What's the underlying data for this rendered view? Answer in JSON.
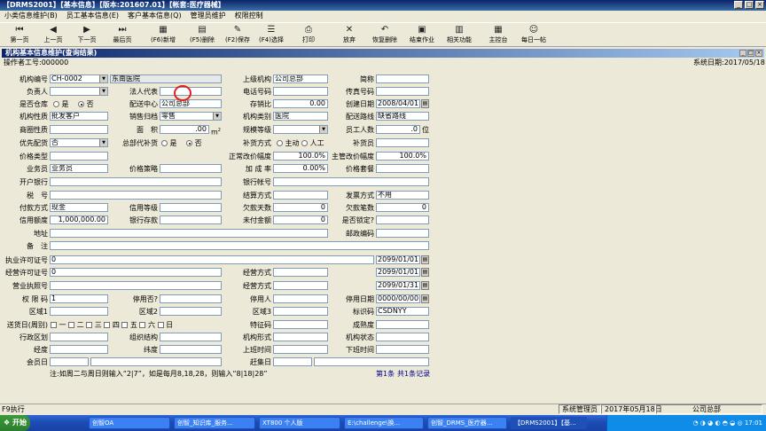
{
  "window": {
    "title": "【DRMS2001】【基本信息】【版本:201607.01】【帐套:医疗器械】"
  },
  "menu": [
    "小类信息维护(B)",
    "员工基本信息(E)",
    "客户基本信息(Q)",
    "管理员维护",
    "权限控制"
  ],
  "toolbar": [
    {
      "name": "first",
      "icon": "⏮",
      "label": "第一页"
    },
    {
      "name": "prev",
      "icon": "◀",
      "label": "上一页"
    },
    {
      "name": "next",
      "icon": "▶",
      "label": "下一页"
    },
    {
      "name": "last",
      "icon": "⏭",
      "label": "最后页"
    },
    {
      "name": "new",
      "icon": "▦",
      "label": "(F6)新增"
    },
    {
      "name": "delete",
      "icon": "▤",
      "label": "(F5)删除"
    },
    {
      "name": "save",
      "icon": "✎",
      "label": "(F2)保存"
    },
    {
      "name": "select",
      "icon": "☰",
      "label": "(F4)选择"
    },
    {
      "name": "print",
      "icon": "⎙",
      "label": "打印"
    },
    {
      "name": "abandon",
      "icon": "✕",
      "label": "放弃"
    },
    {
      "name": "restore",
      "icon": "↶",
      "label": "恢复删除"
    },
    {
      "name": "end",
      "icon": "▣",
      "label": "结束作业"
    },
    {
      "name": "related",
      "icon": "▥",
      "label": "相关功能"
    },
    {
      "name": "console",
      "icon": "▦",
      "label": "主控台"
    },
    {
      "name": "daily",
      "icon": "☺",
      "label": "每日一帖"
    }
  ],
  "frame": {
    "title": "机构基本信息维护(查询结果)",
    "operator": "操作者工号:000000",
    "sysdate": "系统日期:2017/05/18"
  },
  "f": {
    "jgbh": {
      "label": "机构编号",
      "value": "CH-0002"
    },
    "jgname": {
      "value": "东南医院"
    },
    "sjjg": {
      "label": "上级机构",
      "value": "公司总部"
    },
    "jc": {
      "label": "简称"
    },
    "fzr": {
      "label": "负责人"
    },
    "frdb": {
      "label": "法人代表"
    },
    "dhhm": {
      "label": "电话号码"
    },
    "czhm": {
      "label": "传真号码"
    },
    "sfck": {
      "label": "是否仓库",
      "yes": "是",
      "no": "否"
    },
    "pszx": {
      "label": "配送中心",
      "value": "公司总部"
    },
    "cxb": {
      "label": "存销比",
      "value": "0.00"
    },
    "cjrq": {
      "label": "创建日期",
      "value": "2008/04/01"
    },
    "jgxz": {
      "label": "机构性质",
      "value": "批发客户"
    },
    "xsgs": {
      "label": "销售归档",
      "value": "零售"
    },
    "jglb": {
      "label": "机构类别",
      "value": "医院"
    },
    "psxl": {
      "label": "配送路线",
      "value": "缺省路线"
    },
    "sqmc": {
      "label": "商圈性质"
    },
    "mj": {
      "label": "面　积",
      "value": ".00",
      "unit": "m",
      "sup": "2"
    },
    "gmdj": {
      "label": "规模等级"
    },
    "ygrs": {
      "label": "员工人数",
      "value": ".0",
      "unit": "位"
    },
    "yxps": {
      "label": "优先配货",
      "value": "否"
    },
    "zbdbh": {
      "label": "总部代补货",
      "yes": "是",
      "no": "否"
    },
    "bhfs": {
      "label": "补货方式",
      "a": "主动",
      "b": "人工"
    },
    "bhy": {
      "label": "补货员"
    },
    "jglx": {
      "label": "价格类型"
    },
    "zcgjfd": {
      "label": "正常改价幅度",
      "value": "100.0%"
    },
    "zggjfd": {
      "label": "主管改价幅度",
      "value": "100.0%"
    },
    "ywy": {
      "label": "业务员",
      "value": "业务员"
    },
    "jgcl": {
      "label": "价格策略"
    },
    "jcl": {
      "label": "加 成 率",
      "value": "0.00%"
    },
    "jgrq": {
      "label": "价格套餐"
    },
    "khyh": {
      "label": "开户银行"
    },
    "yhzh": {
      "label": "银行帐号"
    },
    "sh": {
      "label": "税　号"
    },
    "jsfs": {
      "label": "结算方式"
    },
    "fpfs": {
      "label": "发票方式",
      "value": "不用"
    },
    "fkfs": {
      "label": "付款方式",
      "value": "现金"
    },
    "xydj": {
      "label": "信用等级"
    },
    "qkts": {
      "label": "欠款天数",
      "value": "0"
    },
    "qkbs": {
      "label": "欠款笔数",
      "value": "0"
    },
    "xyed": {
      "label": "信用额度",
      "value": "1,000,000.00"
    },
    "yhck": {
      "label": "银行存款"
    },
    "wfje": {
      "label": "未付金额",
      "value": "0"
    },
    "sfsd": {
      "label": "是否锁定?"
    },
    "dz": {
      "label": "地址"
    },
    "yzbm": {
      "label": "邮政编码"
    },
    "bz": {
      "label": "备　注"
    },
    "zyxk": {
      "label": "执业许可证号",
      "value": "0",
      "date": "2099/01/01"
    },
    "jyxk": {
      "label": "经营许可证号",
      "value": "0",
      "fw": "经营方式",
      "date": "2099/01/01"
    },
    "yyzz": {
      "label": "营业执照号",
      "fw": "经营方式",
      "date": "2099/01/31"
    },
    "qxm": {
      "label": "权 限 码",
      "value": "1",
      "tyf": "停用否?",
      "tyr": "停用人",
      "tyrq": "停用日期",
      "tyrqv": "0000/00/00"
    },
    "qy1": {
      "label": "区域1",
      "qy2": "区域2",
      "qy3": "区域3",
      "bjm": "标识码",
      "bjmv": "CSDNYY"
    },
    "shr": {
      "label": "送货日(周别)",
      "days": [
        "一",
        "二",
        "三",
        "四",
        "五",
        "六",
        "日"
      ],
      "cxs": "成熟度"
    },
    "xzqh": {
      "label": "行政区划",
      "zzjg": "组织结构",
      "tzj": "特征码",
      "jgxs": "机构形式",
      "jgzt": "机构状态"
    },
    "jd": {
      "label": "经度",
      "wd": "纬度",
      "sbsj": "上班时间",
      "xbsj": "下班时间"
    },
    "hyr": {
      "label": "会员日",
      "zjr": "赶集日"
    }
  },
  "notes": {
    "hint": "注:如周二与周日则输入“2|7”，如是每月8,18,28，则输入“8|18|28”",
    "page": "第1条",
    "total": "共1条记录"
  },
  "statusbar": {
    "left": "F9执行",
    "user": "系统管理员",
    "date": "2017年05月18日",
    "org": "公司总部"
  },
  "taskbar": {
    "start": "开始",
    "tasks": [
      "创智OA",
      "创智_知识库_服务...",
      "XT800 个人版",
      "E:\\challenge\\换...",
      "创智_DRMS_医疗器...",
      "【DRMS2001】【基..."
    ],
    "time": "17:01"
  }
}
